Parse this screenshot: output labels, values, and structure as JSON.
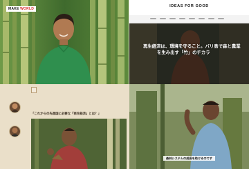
{
  "top_left": {
    "logo_text_main": "MAKE",
    "logo_text_accent": "WORLD"
  },
  "top_right": {
    "site_title": "IDEAS FOR GOOD",
    "site_tagline": "",
    "hero_title_line1": "再生経済は、環境を守ること。バリ島で森と農業",
    "hero_title_line2": "を生み出す「竹」のチカラ",
    "meta_date": "",
    "meta_author": ""
  },
  "bottom_left": {
    "badge": "",
    "breadcrumb": "",
    "intro_line1": "",
    "intro_line2": "",
    "intro_line3": "",
    "headline": "「これからの先進国に必要な『再生経済』とは？」",
    "avatar1_label": "",
    "avatar2_label": ""
  },
  "bottom_right": {
    "caption": "森林システムの成長を助けるのです"
  },
  "colors": {
    "bamboo_green": "#5f8c3a",
    "beige_bg": "#eadfc9",
    "shirt_green": "#2f8f4e"
  }
}
